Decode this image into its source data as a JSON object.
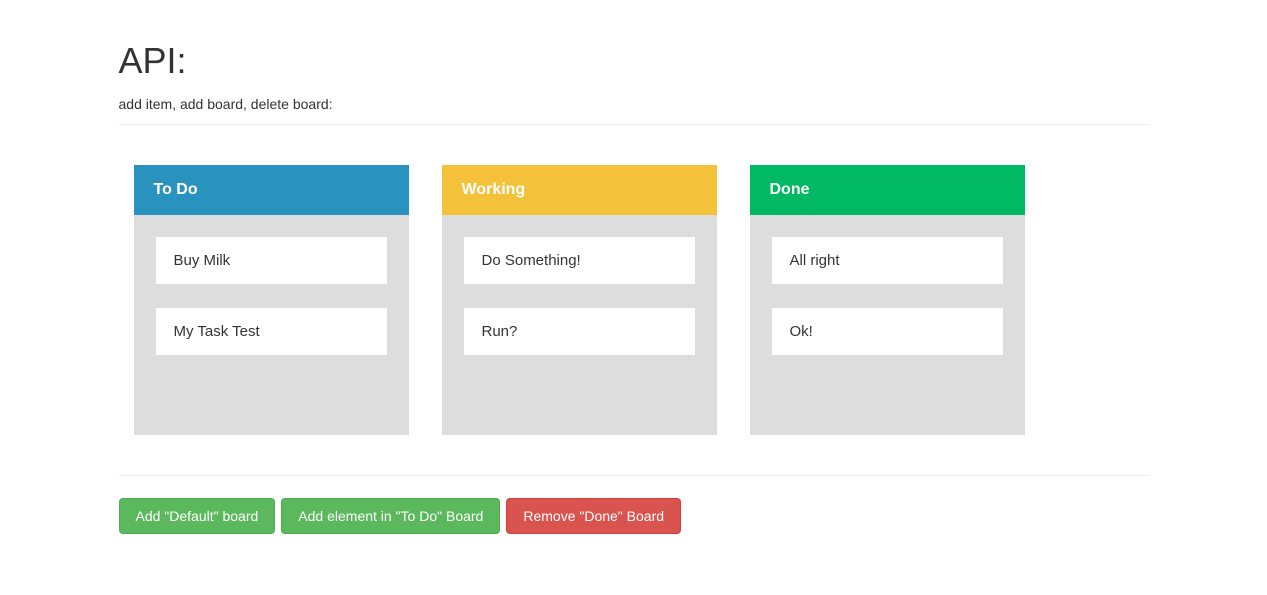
{
  "header": {
    "title": "API:",
    "subtitle": "add item, add board, delete board:"
  },
  "boards": [
    {
      "title": "To Do",
      "headerClass": "blue",
      "items": [
        "Buy Milk",
        "My Task Test"
      ]
    },
    {
      "title": "Working",
      "headerClass": "yellow",
      "items": [
        "Do Something!",
        "Run?"
      ]
    },
    {
      "title": "Done",
      "headerClass": "green",
      "items": [
        "All right",
        "Ok!"
      ]
    }
  ],
  "buttons": {
    "addBoard": "Add \"Default\" board",
    "addElement": "Add element in \"To Do\" Board",
    "removeBoard": "Remove \"Done\" Board"
  }
}
